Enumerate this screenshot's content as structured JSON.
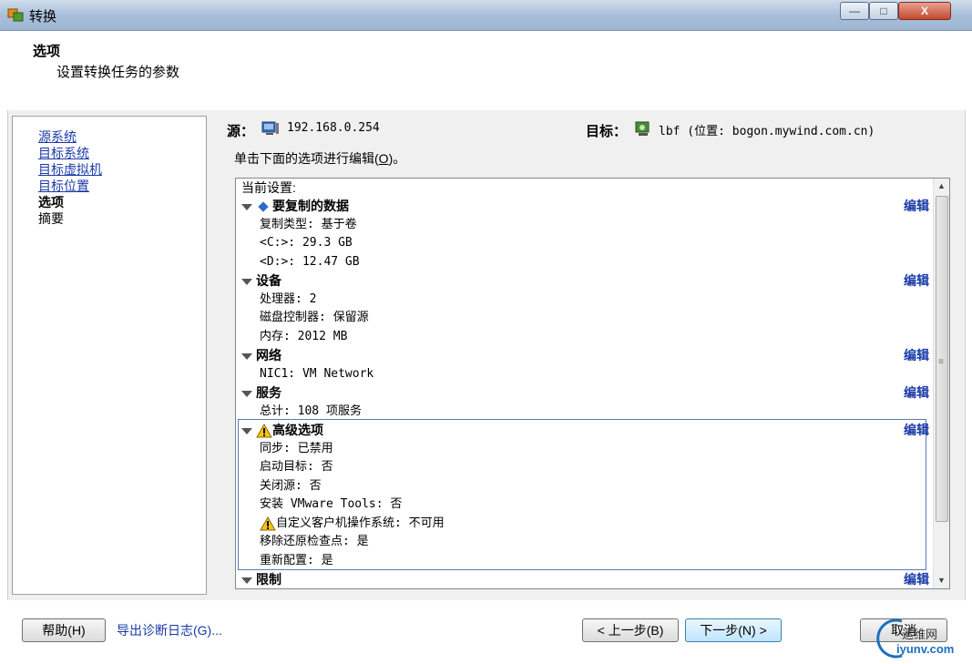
{
  "window": {
    "title": "转换",
    "min_glyph": "—",
    "max_glyph": "□",
    "close_glyph": "X"
  },
  "header": {
    "title": "选项",
    "subtitle": "设置转换任务的参数"
  },
  "nav": {
    "items": [
      {
        "label": "源系统"
      },
      {
        "label": "目标系统"
      },
      {
        "label": "目标虚拟机"
      },
      {
        "label": "目标位置"
      },
      {
        "label": "选项"
      },
      {
        "label": "摘要"
      }
    ]
  },
  "source": {
    "label": "源：",
    "value": "192.168.0.254"
  },
  "target": {
    "label": "目标：",
    "value": "lbf (位置: bogon.mywind.com.cn)"
  },
  "instruction": {
    "text": "单击下面的选项进行编辑(",
    "key": "O",
    "end": ")。"
  },
  "settings": {
    "heading": "当前设置:",
    "edit_label": "编辑",
    "copy_section": "要复制的数据",
    "copy_type": "复制类型: 基于卷",
    "drive_c": "<C:>: 29.3 GB",
    "drive_d": "<D:>: 12.47 GB",
    "devices_section": "设备",
    "processors": "处理器: 2",
    "disk_controller": "磁盘控制器: 保留源",
    "memory": "内存: 2012 MB",
    "network_section": "网络",
    "nic": "NIC1: VM Network",
    "services_section": "服务",
    "services_total": "总计: 108 项服务",
    "advanced_section": "高级选项",
    "sync": "同步: 已禁用",
    "power_on_target": "启动目标: 否",
    "power_off_source": "关闭源: 否",
    "install_tools": "安装 VMware Tools: 否",
    "customize_guest": "自定义客户机操作系统: 不可用",
    "remove_restore": "移除还原检查点: 是",
    "reconfigure": "重新配置: 是",
    "throttle_section": "限制"
  },
  "scrollbar": {
    "up": "▲",
    "down": "▼",
    "grip": "≡"
  },
  "footer": {
    "help_label": "帮助(H)",
    "export_logs_label": "导出诊断日志(G)...",
    "back_label": "< 上一步(B)",
    "next_label": "下一步(N) >",
    "cancel_label": "取消"
  },
  "watermark": {
    "text": "运维网",
    "url": "iyunv.com"
  }
}
